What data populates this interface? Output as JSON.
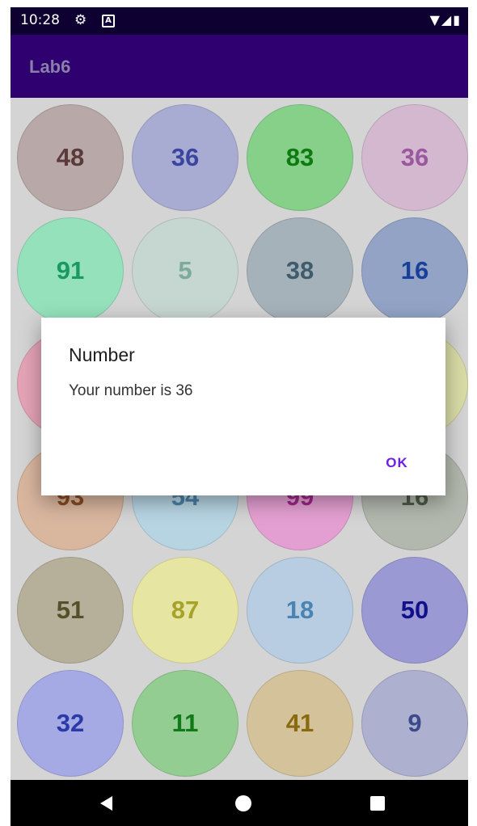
{
  "status_bar": {
    "time": "10:28",
    "gear_icon": "gear-icon",
    "a_icon_label": "A",
    "right_icons": "▼◢▮"
  },
  "app_bar": {
    "title": "Lab6"
  },
  "grid": {
    "items": [
      {
        "number": "48",
        "bg": "#b8a8a8",
        "fg": "#5a3a3a"
      },
      {
        "number": "36",
        "bg": "#a9acd2",
        "fg": "#3a45a0"
      },
      {
        "number": "83",
        "bg": "#86d08a",
        "fg": "#0e7a12"
      },
      {
        "number": "36",
        "bg": "#d4b8cf",
        "fg": "#9a58a0"
      },
      {
        "number": "91",
        "bg": "#94e1bc",
        "fg": "#1a9a62"
      },
      {
        "number": "5",
        "bg": "#c6d6d0",
        "fg": "#7cab9c"
      },
      {
        "number": "38",
        "bg": "#a6b2ba",
        "fg": "#3f5c6c"
      },
      {
        "number": "16",
        "bg": "#93a3c6",
        "fg": "#18409a"
      },
      {
        "number": "",
        "bg": "#e5a3b7",
        "fg": "#a03a60"
      },
      {
        "number": "",
        "bg": "#d0d0d0",
        "fg": "#808080"
      },
      {
        "number": "",
        "bg": "#d0d0d0",
        "fg": "#808080"
      },
      {
        "number": "",
        "bg": "#d9dca6",
        "fg": "#7a7a30"
      },
      {
        "number": "93",
        "bg": "#d9b69e",
        "fg": "#8a4a20"
      },
      {
        "number": "54",
        "bg": "#b7d4e3",
        "fg": "#4a82a6"
      },
      {
        "number": "99",
        "bg": "#e39fd1",
        "fg": "#a0258a"
      },
      {
        "number": "16",
        "bg": "#b2b8ad",
        "fg": "#4c5a48"
      },
      {
        "number": "51",
        "bg": "#b6b09a",
        "fg": "#55502c"
      },
      {
        "number": "87",
        "bg": "#e7e5a2",
        "fg": "#a6a22a"
      },
      {
        "number": "18",
        "bg": "#b8cde1",
        "fg": "#4a84b4"
      },
      {
        "number": "50",
        "bg": "#9b99d4",
        "fg": "#10108a"
      },
      {
        "number": "32",
        "bg": "#a6aae4",
        "fg": "#2a3aa8"
      },
      {
        "number": "11",
        "bg": "#94cd92",
        "fg": "#107a18"
      },
      {
        "number": "41",
        "bg": "#d4c29b",
        "fg": "#8a6a10"
      },
      {
        "number": "9",
        "bg": "#aeb0cf",
        "fg": "#3a4a8a"
      }
    ]
  },
  "dialog": {
    "title": "Number",
    "message": "Your number is 36",
    "ok_label": "OK"
  },
  "nav_bar": {
    "back_icon": "back-triangle-icon",
    "home_icon": "home-circle-icon",
    "recents_icon": "recents-square-icon"
  }
}
